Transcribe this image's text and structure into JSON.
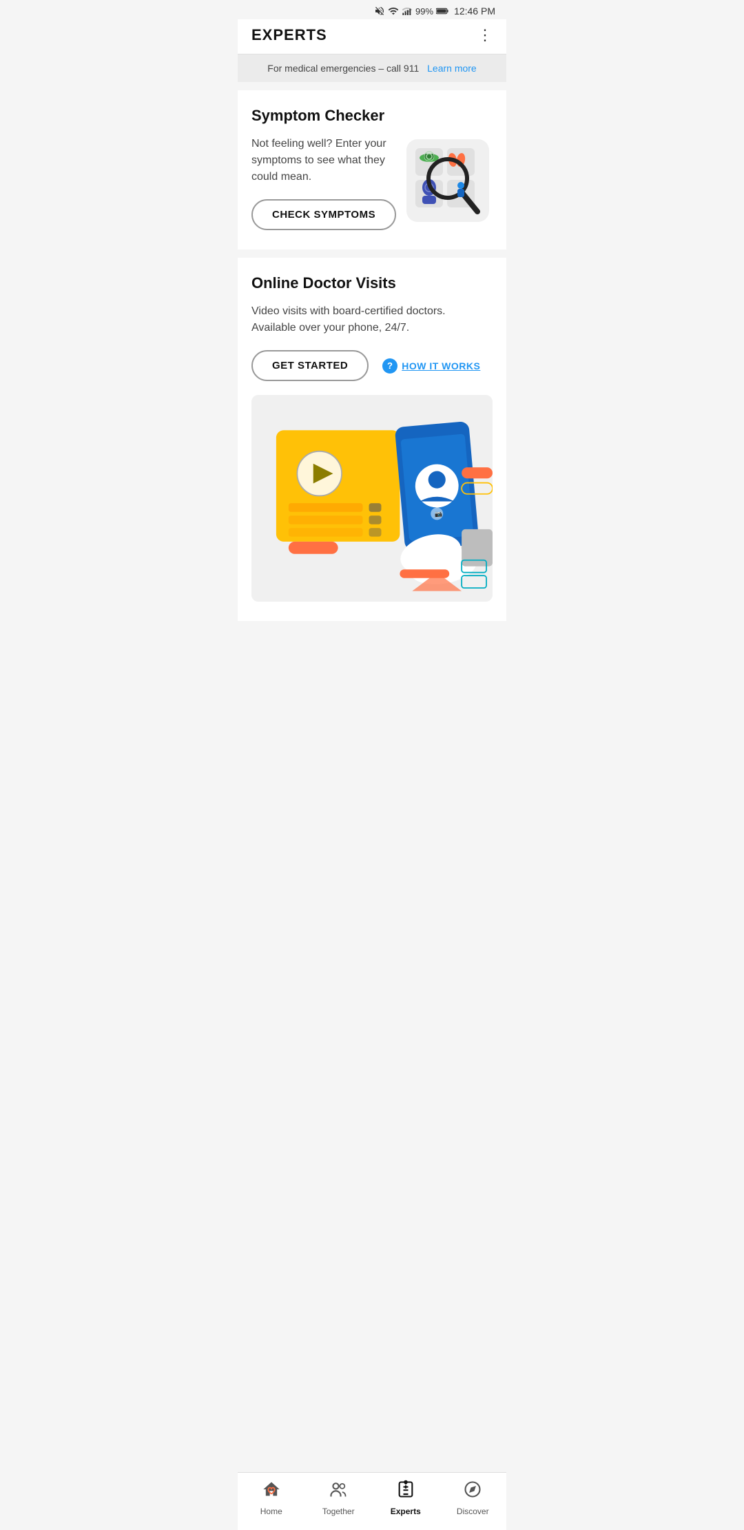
{
  "status_bar": {
    "battery": "99%",
    "time": "12:46 PM"
  },
  "header": {
    "title": "EXPERTS",
    "menu_icon": "⋮"
  },
  "emergency_banner": {
    "text": "For medical emergencies – call 911",
    "link_text": "Learn more"
  },
  "symptom_checker": {
    "title": "Symptom Checker",
    "description": "Not feeling well? Enter your symptoms to see what they could mean.",
    "button_label": "CHECK SYMPTOMS"
  },
  "online_doctor": {
    "title": "Online Doctor Visits",
    "description": "Video visits with board-certified doctors. Available over your phone, 24/7.",
    "get_started_label": "GET STARTED",
    "how_it_works_label": "HOW IT WORKS"
  },
  "bottom_nav": {
    "items": [
      {
        "label": "Home",
        "icon": "home"
      },
      {
        "label": "Together",
        "icon": "together"
      },
      {
        "label": "Experts",
        "icon": "experts",
        "active": true
      },
      {
        "label": "Discover",
        "icon": "discover"
      }
    ]
  }
}
